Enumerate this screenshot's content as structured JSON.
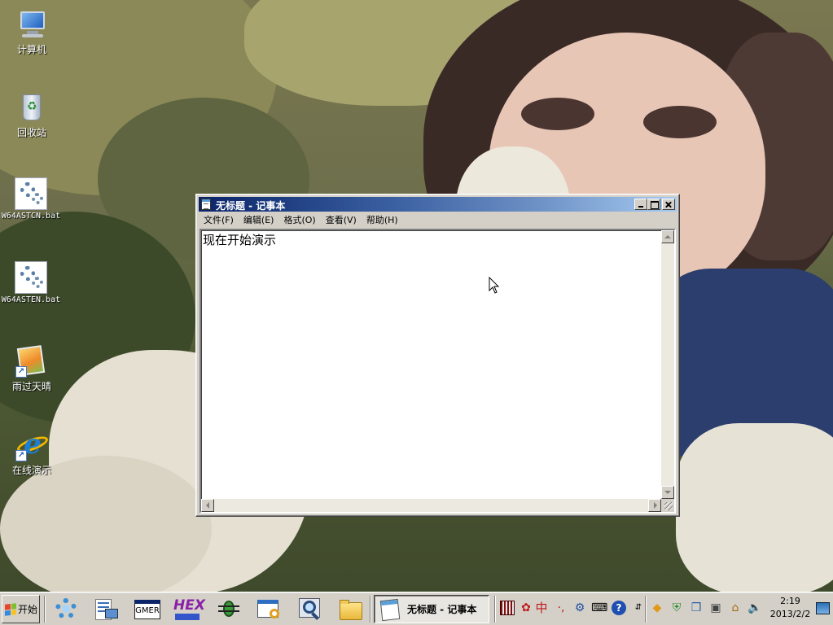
{
  "desktop": {
    "icons": [
      {
        "label": "计算机",
        "icon": "computer-icon"
      },
      {
        "label": "回收站",
        "icon": "recycle-bin-icon"
      },
      {
        "label": "W64ASTCN.bat",
        "icon": "batch-file-gear-icon"
      },
      {
        "label": "W64ASTEN.bat",
        "icon": "batch-file-gear-icon"
      },
      {
        "label": "雨过天晴",
        "icon": "photo-shortcut-icon"
      },
      {
        "label": "在线演示",
        "icon": "internet-explorer-icon"
      }
    ]
  },
  "notepad": {
    "title": "无标题 - 记事本",
    "menu": [
      "文件(F)",
      "编辑(E)",
      "格式(O)",
      "查看(V)",
      "帮助(H)"
    ],
    "content": "现在开始演示"
  },
  "taskbar": {
    "start_label": "开始",
    "quick_launch": [
      "gear-app-icon",
      "network-connections-icon",
      "gmer-icon",
      "hex-editor-icon",
      "bug-scanner-icon",
      "window-settings-icon",
      "magnifier-icon",
      "folder-icon"
    ],
    "gmer_label": "GMER",
    "hex_label": "HEX",
    "active_task": "无标题 - 记事本",
    "ime_lang": "中",
    "clock_time": "2:19",
    "clock_date": "2013/2/2"
  },
  "colors": {
    "titlebar_start": "#0a246a",
    "titlebar_end": "#a6caf0",
    "chrome": "#d4d0c8"
  }
}
